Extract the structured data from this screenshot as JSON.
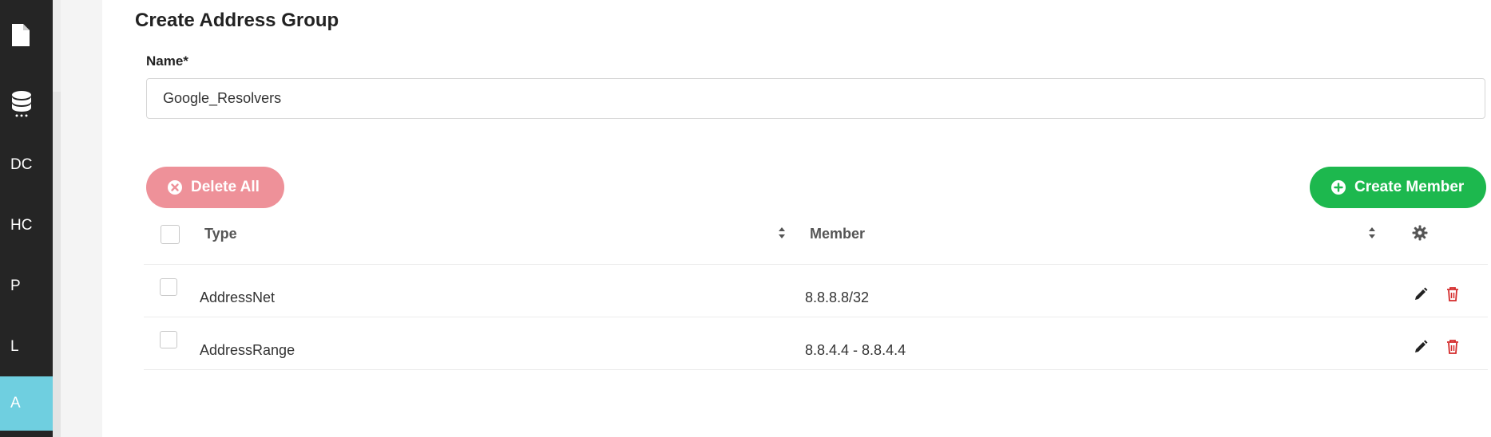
{
  "sidebar": {
    "items": [
      {
        "label": "",
        "icon": "document-icon"
      },
      {
        "label": "",
        "icon": "database-icon"
      },
      {
        "label": "DC"
      },
      {
        "label": "HC"
      },
      {
        "label": "P"
      },
      {
        "label": "L"
      },
      {
        "label": "A",
        "active": true
      }
    ],
    "active_color": "#6fcfe0"
  },
  "page": {
    "title": "Create Address Group"
  },
  "form": {
    "name_label": "Name*",
    "name_value": "Google_Resolvers"
  },
  "buttons": {
    "delete_all": "Delete All",
    "create_member": "Create Member",
    "delete_color": "#ee9199",
    "create_color": "#1db84e"
  },
  "table": {
    "columns": [
      "Type",
      "Member"
    ],
    "rows": [
      {
        "type": "AddressNet",
        "member": "8.8.8.8/32"
      },
      {
        "type": "AddressRange",
        "member": "8.8.4.4 - 8.8.4.4"
      }
    ]
  }
}
